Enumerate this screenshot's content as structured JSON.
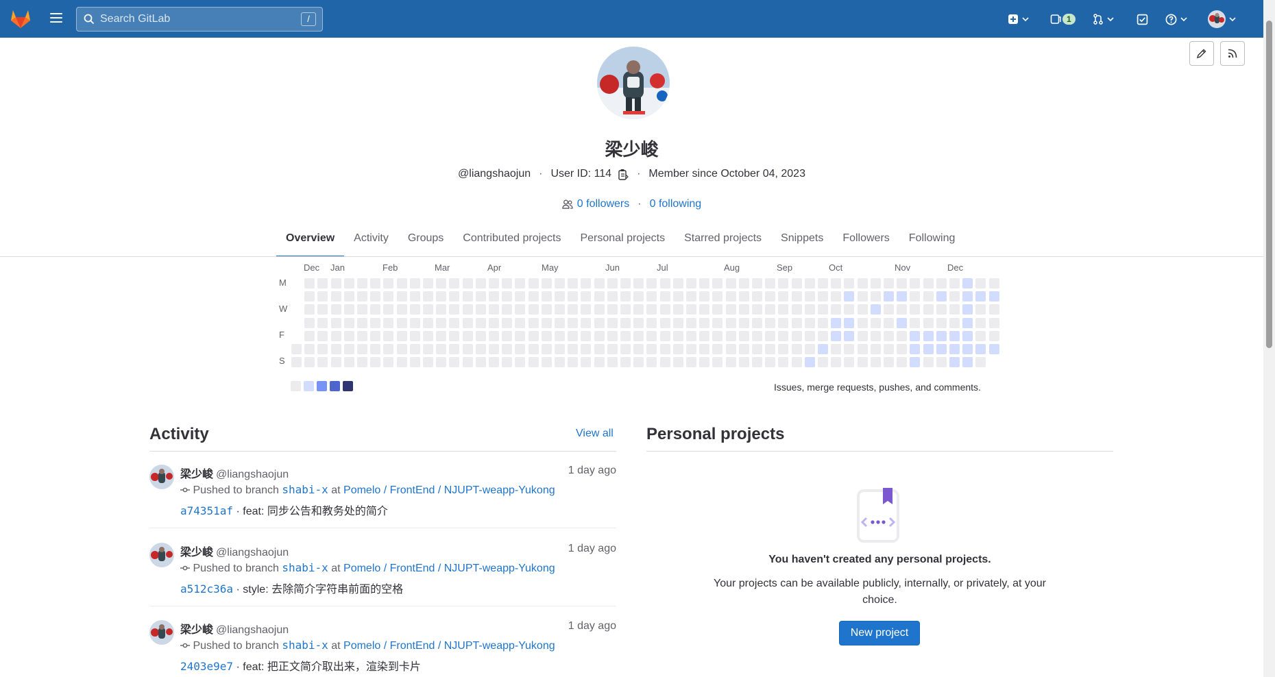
{
  "topbar": {
    "search_placeholder": "Search GitLab",
    "search_shortcut": "/",
    "issues_count": "1"
  },
  "profile": {
    "name": "梁少峻",
    "handle": "@liangshaojun",
    "user_id": "User ID: 114",
    "member_since": "Member since October 04, 2023",
    "followers": "0 followers",
    "following": "0 following"
  },
  "tabs": [
    "Overview",
    "Activity",
    "Groups",
    "Contributed projects",
    "Personal projects",
    "Starred projects",
    "Snippets",
    "Followers",
    "Following"
  ],
  "calendar": {
    "months": [
      "Dec",
      "Jan",
      "Feb",
      "Mar",
      "Apr",
      "May",
      "Jun",
      "Jul",
      "Aug",
      "Sep",
      "Oct",
      "Nov",
      "Dec"
    ],
    "day_labels": [
      "M",
      "W",
      "F",
      "S"
    ],
    "legend_text": "Issues, merge requests, pushes, and comments.",
    "colors": [
      "#ececef",
      "#d2dcff",
      "#7992f5",
      "#4e65cd",
      "#303470"
    ]
  },
  "activity": {
    "title": "Activity",
    "view_all": "View all",
    "events": [
      {
        "author": "梁少峻",
        "handle": "@liangshaojun",
        "time": "1 day ago",
        "action": "Pushed to branch",
        "branch": "shabi-x",
        "at": "at",
        "project": "Pomelo / FrontEnd / NJUPT-weapp-Yukong",
        "commit": "a74351af",
        "message": "· feat: 同步公告和教务处的简介"
      },
      {
        "author": "梁少峻",
        "handle": "@liangshaojun",
        "time": "1 day ago",
        "action": "Pushed to branch",
        "branch": "shabi-x",
        "at": "at",
        "project": "Pomelo / FrontEnd / NJUPT-weapp-Yukong",
        "commit": "a512c36a",
        "message": "· style: 去除简介字符串前面的空格"
      },
      {
        "author": "梁少峻",
        "handle": "@liangshaojun",
        "time": "1 day ago",
        "action": "Pushed to branch",
        "branch": "shabi-x",
        "at": "at",
        "project": "Pomelo / FrontEnd / NJUPT-weapp-Yukong",
        "commit": "2403e9e7",
        "message": "· feat: 把正文简介取出来，渲染到卡片"
      }
    ]
  },
  "personal_projects": {
    "title": "Personal projects",
    "empty_title": "You haven't created any personal projects.",
    "empty_desc": "Your projects can be available publicly, internally, or privately, at your choice.",
    "new_project": "New project"
  }
}
